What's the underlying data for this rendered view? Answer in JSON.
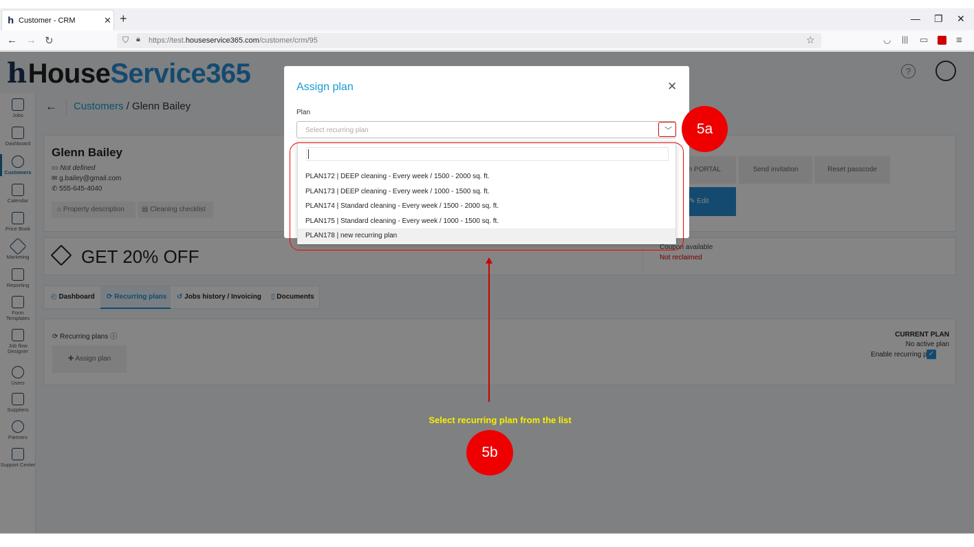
{
  "browser": {
    "tab_title": "Customer - CRM",
    "url_prefix": "https://test.",
    "url_domain": "houseservice365.com",
    "url_path": "/customer/crm/95"
  },
  "app": {
    "logo_part1": "House",
    "logo_part2": "Service365",
    "breadcrumb_link": "Customers",
    "breadcrumb_sep": " / ",
    "breadcrumb_current": "Glenn Bailey"
  },
  "sidebar": {
    "items": [
      {
        "label": "Jobs",
        "icon": "jobs-icon"
      },
      {
        "label": "Dashboard",
        "icon": "dashboard-icon"
      },
      {
        "label": "Customers",
        "icon": "customers-icon",
        "active": true
      },
      {
        "label": "Calendar",
        "icon": "calendar-icon"
      },
      {
        "label": "Price Book",
        "icon": "price-book-icon"
      },
      {
        "label": "Marketing",
        "icon": "marketing-icon"
      },
      {
        "label": "Reporting",
        "icon": "reporting-icon"
      },
      {
        "label": "Form Templates",
        "icon": "form-templates-icon"
      },
      {
        "label": "Job flow Designer",
        "icon": "job-flow-icon"
      },
      {
        "label": "Users",
        "icon": "users-icon"
      },
      {
        "label": "Suppliers",
        "icon": "suppliers-icon"
      },
      {
        "label": "Partners",
        "icon": "partners-icon"
      },
      {
        "label": "Support Center",
        "icon": "support-icon"
      }
    ]
  },
  "customer": {
    "name": "Glenn Bailey",
    "address": "Not defined",
    "email": "g.bailey@gmail.com",
    "phone": "555-645-4040",
    "property_btn": "Property description",
    "checklist_btn": "Cleaning checklist",
    "portal_btn": "ch PORTAL",
    "invite_btn": "Send invitation",
    "reset_btn": "Reset passcode",
    "edit_btn": "Edit"
  },
  "coupon": {
    "title": "GET 20% OFF",
    "available": "Coupon available",
    "status": "Not reclaimed"
  },
  "tabs": [
    {
      "label": "Dashboard"
    },
    {
      "label": "Recurring plans",
      "active": true
    },
    {
      "label": "Jobs history / Invoicing"
    },
    {
      "label": "Documents"
    }
  ],
  "recurring": {
    "title": "Recurring plans",
    "assign_btn": "Assign plan",
    "current_plan_title": "CURRENT PLAN",
    "current_plan_value": "No active plan",
    "enable_label": "Enable recurring plan"
  },
  "modal": {
    "title": "Assign plan",
    "plan_label": "Plan",
    "placeholder": "Select recurring plan",
    "options": [
      "PLAN172 | DEEP cleaning - Every week / 1500 - 2000 sq. ft.",
      "PLAN173 | DEEP cleaning - Every week / 1000 - 1500 sq. ft.",
      "PLAN174 | Standard cleaning - Every week / 1500 - 2000 sq. ft.",
      "PLAN175 | Standard cleaning - Every week / 1000 - 1500 sq. ft.",
      "PLAN178 | new recurring plan"
    ]
  },
  "annotations": {
    "badge_a": "5a",
    "badge_b": "5b",
    "hint": "Select recurring plan from the list"
  },
  "colors": {
    "accent": "#1a9ad6",
    "annotation_red": "#e00000",
    "hint_yellow": "#f6f000"
  }
}
